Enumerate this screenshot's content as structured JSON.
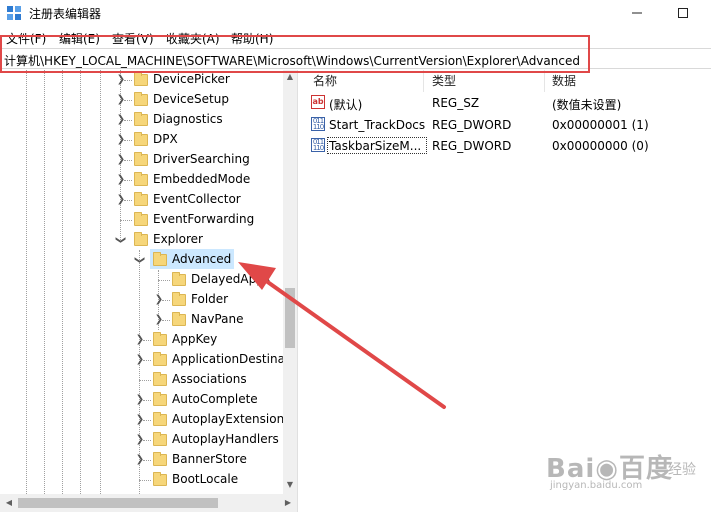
{
  "window": {
    "title": "注册表编辑器"
  },
  "menu": [
    "文件(F)",
    "编辑(E)",
    "查看(V)",
    "收藏夹(A)",
    "帮助(H)"
  ],
  "address": "计算机\\HKEY_LOCAL_MACHINE\\SOFTWARE\\Microsoft\\Windows\\CurrentVersion\\Explorer\\Advanced",
  "tree": {
    "items": [
      {
        "label": "DevicePicker",
        "expander": "collapsed"
      },
      {
        "label": "DeviceSetup",
        "expander": "collapsed"
      },
      {
        "label": "Diagnostics",
        "expander": "collapsed"
      },
      {
        "label": "DPX",
        "expander": "collapsed"
      },
      {
        "label": "DriverSearching",
        "expander": "collapsed"
      },
      {
        "label": "EmbeddedMode",
        "expander": "collapsed"
      },
      {
        "label": "EventCollector",
        "expander": "collapsed"
      },
      {
        "label": "EventForwarding",
        "expander": "none"
      },
      {
        "label": "Explorer",
        "expander": "expanded"
      },
      {
        "label": "Advanced",
        "expander": "expanded",
        "selected": true
      },
      {
        "label": "DelayedApps",
        "expander": "none"
      },
      {
        "label": "Folder",
        "expander": "collapsed"
      },
      {
        "label": "NavPane",
        "expander": "collapsed"
      },
      {
        "label": "AppKey",
        "expander": "collapsed"
      },
      {
        "label": "ApplicationDestinations",
        "expander": "collapsed"
      },
      {
        "label": "Associations",
        "expander": "none"
      },
      {
        "label": "AutoComplete",
        "expander": "collapsed"
      },
      {
        "label": "AutoplayExtensions",
        "expander": "collapsed"
      },
      {
        "label": "AutoplayHandlers",
        "expander": "collapsed"
      },
      {
        "label": "BannerStore",
        "expander": "collapsed"
      },
      {
        "label": "BootLocale",
        "expander": "none"
      }
    ]
  },
  "list": {
    "headers": {
      "name": "名称",
      "type": "类型",
      "data": "数据"
    },
    "rows": [
      {
        "icon": "string-value-icon",
        "name": "(默认)",
        "type": "REG_SZ",
        "data": "(数值未设置)"
      },
      {
        "icon": "binary-value-icon",
        "name": "Start_TrackDocs",
        "type": "REG_DWORD",
        "data": "0x00000001 (1)"
      },
      {
        "icon": "binary-value-icon",
        "name": "TaskbarSizeM...",
        "type": "REG_DWORD",
        "data": "0x00000000 (0)"
      }
    ]
  },
  "watermark": {
    "brand": "Bai◉百度",
    "suffix": "经验",
    "url": "jingyan.baidu.com"
  },
  "colors": {
    "annotation": "#e04848",
    "selection": "#cce8ff",
    "folder": "#f6d67a"
  }
}
